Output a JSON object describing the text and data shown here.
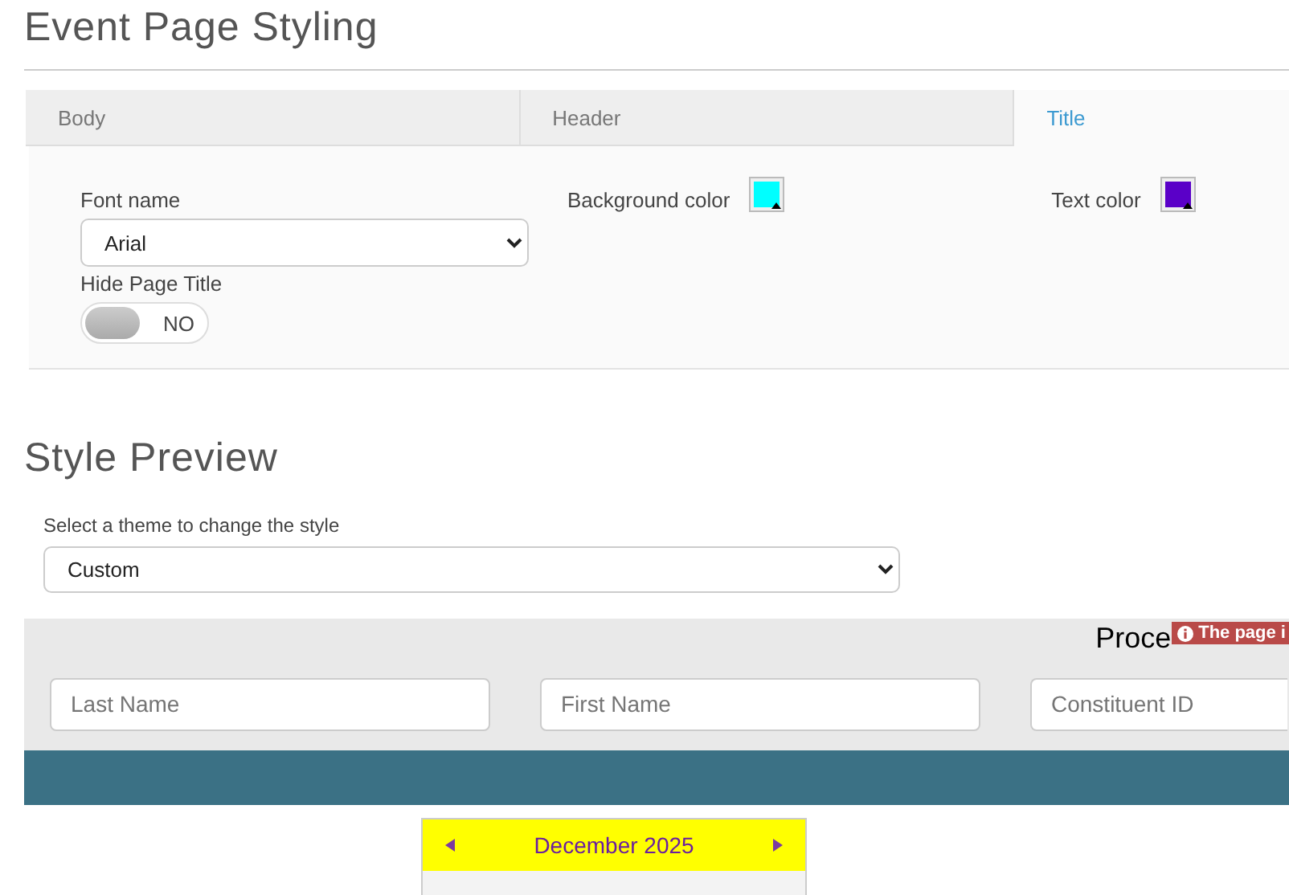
{
  "title": "Event Page Styling",
  "tabs": [
    {
      "label": "Body",
      "selected": false
    },
    {
      "label": "Header",
      "selected": false
    },
    {
      "label": "Title",
      "selected": true
    }
  ],
  "font_name": {
    "label": "Font name",
    "value": "Arial"
  },
  "background_color": {
    "label": "Background color",
    "color": "#00ffff"
  },
  "text_color": {
    "label": "Text color",
    "color": "#5a00c8"
  },
  "hide_page_title": {
    "label": "Hide Page Title",
    "on": false,
    "text": "NO"
  },
  "preview": {
    "title": "Style Preview",
    "theme_label": "Select a theme to change the style",
    "theme": "Custom",
    "processing": "Proce",
    "alert": "The page i",
    "fields": [
      {
        "placeholder": "Last Name"
      },
      {
        "placeholder": "First Name"
      },
      {
        "placeholder": "Constituent ID"
      }
    ],
    "calendar": {
      "month": "December 2025"
    }
  }
}
